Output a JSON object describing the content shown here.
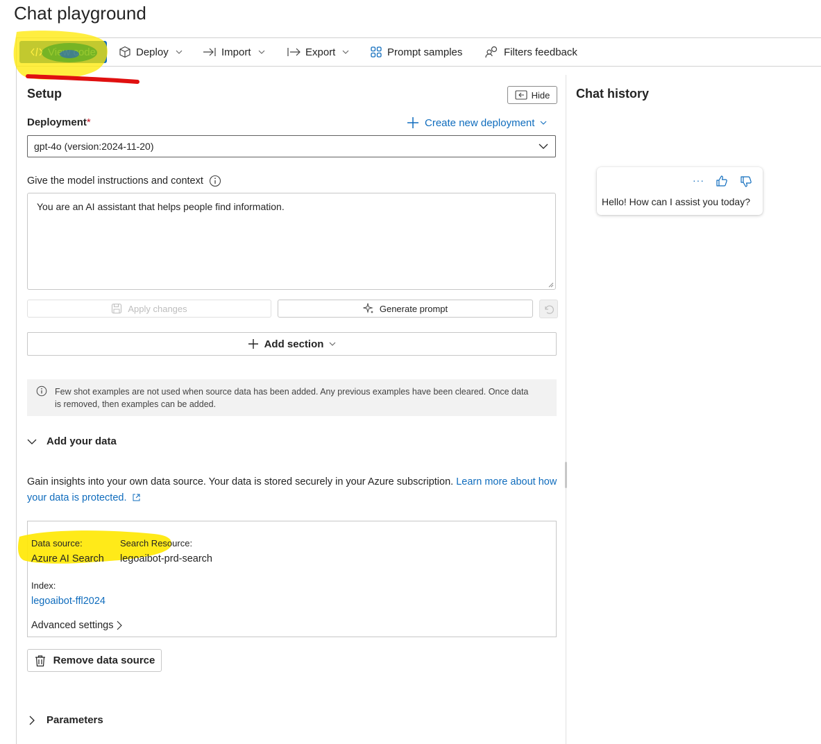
{
  "page": {
    "title": "Chat playground"
  },
  "toolbar": {
    "view_code": "View code",
    "deploy": "Deploy",
    "import": "Import",
    "export": "Export",
    "prompt_samples": "Prompt samples",
    "filters_feedback": "Filters feedback"
  },
  "setup": {
    "title": "Setup",
    "hide_label": "Hide",
    "deployment_label": "Deployment",
    "required_marker": "*",
    "create_deployment": "Create new deployment",
    "deployment_value": "gpt-4o (version:2024-11-20)",
    "instructions_label": "Give the model instructions and context",
    "instructions_value": "You are an AI assistant that helps people find information.",
    "apply_changes": "Apply changes",
    "generate_prompt": "Generate prompt",
    "add_section": "Add section",
    "info_text": "Few shot examples are not used when source data has been added. Any previous examples have been cleared. Once data is removed, then examples can be added.",
    "add_your_data": "Add your data",
    "gain_text": "Gain insights into your own data source. Your data is stored securely in your Azure subscription.",
    "learn_more": "Learn more about how your data is protected.",
    "data_source_label": "Data source:",
    "data_source_value": "Azure AI Search",
    "search_resource_label": "Search Resource:",
    "search_resource_value": "legoaibot-prd-search",
    "index_label": "Index:",
    "index_value": "legoaibot-ffl2024",
    "advanced_settings": "Advanced settings",
    "remove_data_source": "Remove data source",
    "parameters": "Parameters"
  },
  "chat": {
    "title": "Chat history",
    "message": "Hello! How can I assist you today?",
    "more_label": "···"
  },
  "colors": {
    "primary": "#0f6cbd",
    "link": "#0f6cbd",
    "required": "#c50f1f",
    "highlight_yellow": "#ffe800",
    "highlight_green": "#1a9c1a",
    "annotation_red": "#e01010"
  }
}
